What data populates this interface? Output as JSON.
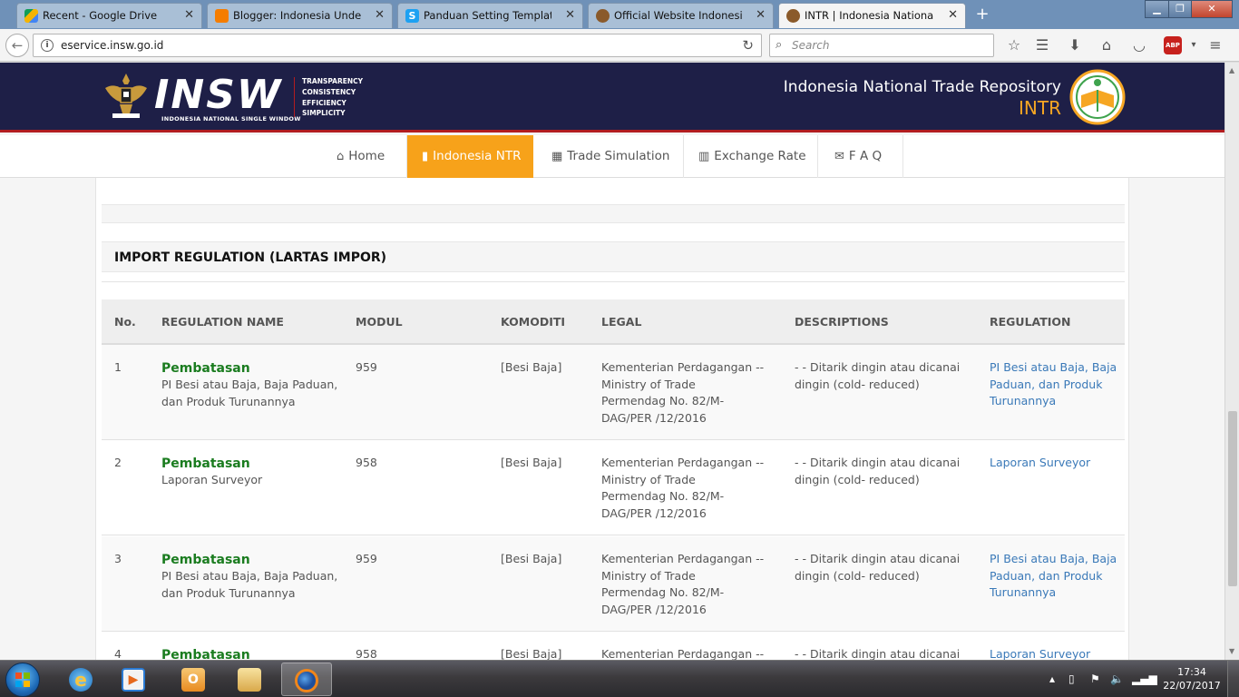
{
  "browser": {
    "tabs": [
      {
        "title": "Recent - Google Drive",
        "active": false,
        "favicon_color": "#f4b400"
      },
      {
        "title": "Blogger: Indonesia Underman",
        "active": false,
        "favicon_color": "#f57d00"
      },
      {
        "title": "Panduan Setting Template Ex",
        "active": false,
        "favicon_color": "#1da1f2"
      },
      {
        "title": "Official Website Indonesia Na",
        "active": false,
        "favicon_color": "#8a5a2b"
      },
      {
        "title": "INTR | Indonesia National Tra",
        "active": true,
        "favicon_color": "#8a5a2b"
      }
    ],
    "url": "eservice.insw.go.id",
    "search_placeholder": "Search"
  },
  "header": {
    "logo_text": "INSW",
    "logo_subtitle": "INDONESIA NATIONAL SINGLE WINDOW",
    "values": [
      "TRANSPARENCY",
      "CONSISTENCY",
      "EFFICIENCY",
      "SIMPLICITY"
    ],
    "repo_title": "Indonesia National Trade Repository",
    "repo_abbr": "INTR"
  },
  "nav": [
    {
      "label": "Home",
      "icon": "home-icon",
      "active": false
    },
    {
      "label": "Indonesia NTR",
      "icon": "book-icon",
      "active": true
    },
    {
      "label": "Trade Simulation",
      "icon": "grid-icon",
      "active": false
    },
    {
      "label": "Exchange Rate",
      "icon": "barcode-icon",
      "active": false
    },
    {
      "label": "F A Q",
      "icon": "envelope-icon",
      "active": false
    }
  ],
  "section": {
    "title": "IMPORT REGULATION (LARTAS IMPOR)"
  },
  "table": {
    "columns": [
      "No.",
      "REGULATION NAME",
      "MODUL",
      "KOMODITI",
      "LEGAL",
      "DESCRIPTIONS",
      "REGULATION"
    ],
    "rows": [
      {
        "no": "1",
        "type": "Pembatasan",
        "name_line1": "PI Besi atau Baja, Baja Paduan,",
        "name_line2": "dan Produk Turunannya",
        "modul": "959",
        "komoditi": "[Besi Baja]",
        "legal_line1": "Kementerian Perdagangan --",
        "legal_line2": "Ministry of Trade",
        "legal_line3": "Permendag No. 82/M-",
        "legal_line4": "DAG/PER /12/2016",
        "desc_line1": "- - Ditarik dingin atau dicanai",
        "desc_line2": "dingin (cold- reduced)",
        "reg_line1": "PI Besi atau Baja, Baja",
        "reg_line2": "Paduan, dan Produk",
        "reg_line3": "Turunannya"
      },
      {
        "no": "2",
        "type": "Pembatasan",
        "name_line1": "Laporan Surveyor",
        "name_line2": "",
        "modul": "958",
        "komoditi": "[Besi Baja]",
        "legal_line1": "Kementerian Perdagangan --",
        "legal_line2": "Ministry of Trade",
        "legal_line3": "Permendag No. 82/M-",
        "legal_line4": "DAG/PER /12/2016",
        "desc_line1": "- - Ditarik dingin atau dicanai",
        "desc_line2": "dingin (cold- reduced)",
        "reg_line1": "Laporan Surveyor",
        "reg_line2": "",
        "reg_line3": ""
      },
      {
        "no": "3",
        "type": "Pembatasan",
        "name_line1": "PI Besi atau Baja, Baja Paduan,",
        "name_line2": "dan Produk Turunannya",
        "modul": "959",
        "komoditi": "[Besi Baja]",
        "legal_line1": "Kementerian Perdagangan --",
        "legal_line2": "Ministry of Trade",
        "legal_line3": "Permendag No. 82/M-",
        "legal_line4": "DAG/PER /12/2016",
        "desc_line1": "- - Ditarik dingin atau dicanai",
        "desc_line2": "dingin (cold- reduced)",
        "reg_line1": "PI Besi atau Baja, Baja",
        "reg_line2": "Paduan, dan Produk",
        "reg_line3": "Turunannya"
      },
      {
        "no": "4",
        "type": "Pembatasan",
        "name_line1": "",
        "name_line2": "",
        "modul": "958",
        "komoditi": "[Besi Baja]",
        "legal_line1": "Kementerian Perdagangan --",
        "legal_line2": "",
        "legal_line3": "",
        "legal_line4": "",
        "desc_line1": "- - Ditarik dingin atau dicanai",
        "desc_line2": "",
        "reg_line1": "Laporan Surveyor",
        "reg_line2": "",
        "reg_line3": ""
      }
    ]
  },
  "taskbar": {
    "clock_time": "17:34",
    "clock_date": "22/07/2017"
  },
  "colors": {
    "header_bg": "#1e1f47",
    "accent_orange": "#f7a21a",
    "regulation_green": "#1a7c1f",
    "link_blue": "#3a79b8"
  }
}
